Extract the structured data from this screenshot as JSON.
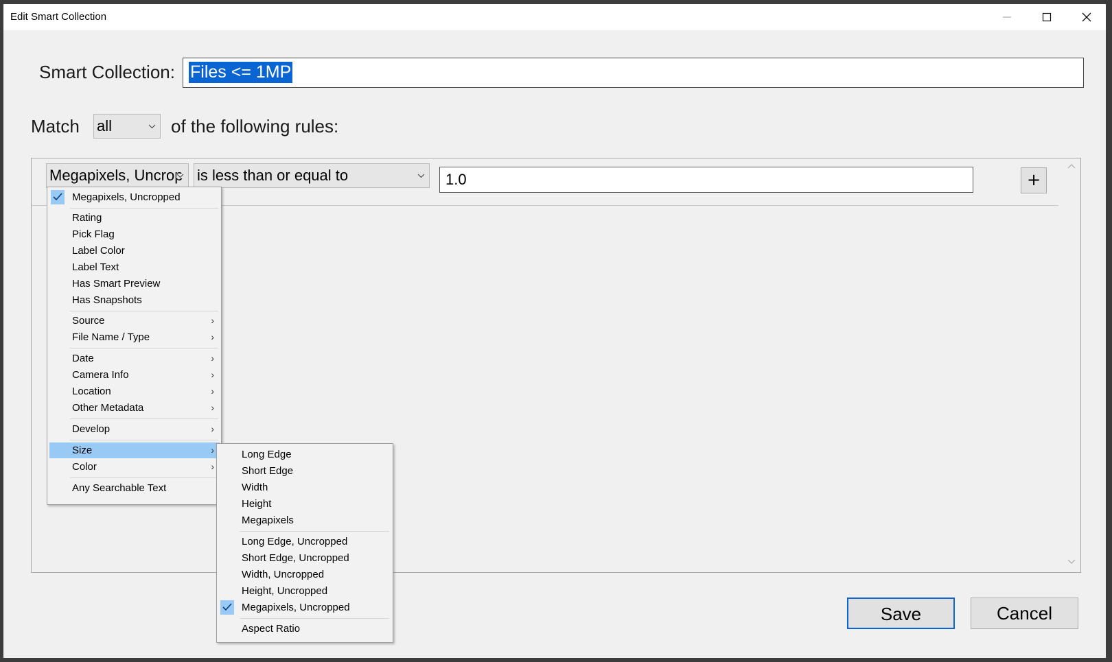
{
  "window": {
    "title": "Edit Smart Collection"
  },
  "form": {
    "name_label": "Smart Collection:",
    "name_value": "Files <= 1MP",
    "match_label": "Match",
    "match_value": "all",
    "match_suffix": "of the following rules:"
  },
  "rule": {
    "field": "Megapixels, Uncropped",
    "field_visible": "Megapixels, Uncrop",
    "operator": "is less than or equal to",
    "value": "1.0",
    "add_label": "+"
  },
  "field_menu": {
    "checked_item": "Megapixels, Uncropped",
    "groups": [
      [
        "Rating",
        "Pick Flag",
        "Label Color",
        "Label Text",
        "Has Smart Preview",
        "Has Snapshots"
      ],
      [
        "Source",
        "File Name / Type"
      ],
      [
        "Date",
        "Camera Info",
        "Location",
        "Other Metadata"
      ],
      [
        "Develop"
      ],
      [
        "Size",
        "Color"
      ],
      [
        "Any Searchable Text"
      ]
    ],
    "highlighted": "Size"
  },
  "size_submenu": {
    "groups": [
      [
        "Long Edge",
        "Short Edge",
        "Width",
        "Height",
        "Megapixels"
      ],
      [
        "Long Edge, Uncropped",
        "Short Edge, Uncropped",
        "Width, Uncropped",
        "Height, Uncropped",
        "Megapixels, Uncropped"
      ],
      [
        "Aspect Ratio"
      ]
    ],
    "checked": "Megapixels, Uncropped"
  },
  "buttons": {
    "save": "Save",
    "cancel": "Cancel"
  },
  "colors": {
    "accent": "#0a64d2",
    "highlight": "#99c9f5"
  }
}
